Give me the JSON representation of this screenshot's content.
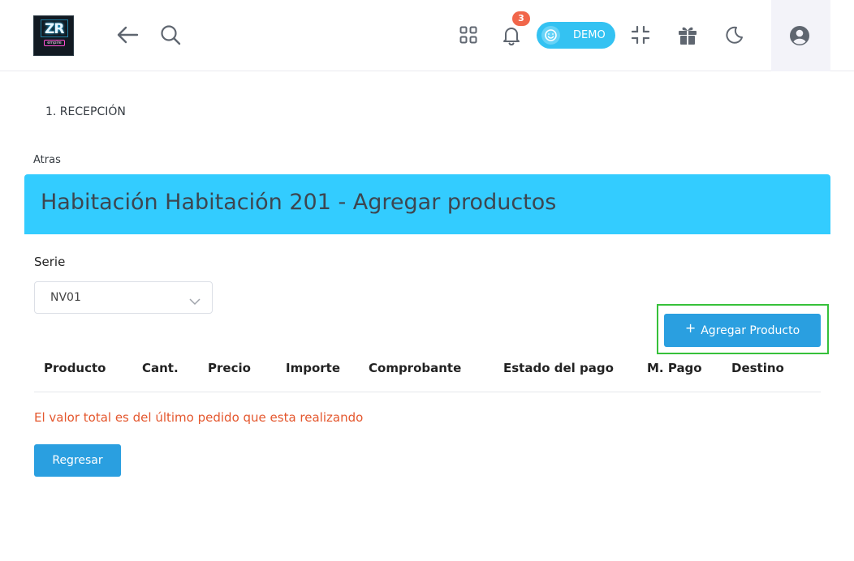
{
  "header": {
    "notification_count": "3",
    "demo_label": "DEMO",
    "icons": [
      "back-arrow-icon",
      "search-icon",
      "apps-grid-icon",
      "bell-icon",
      "smiley-icon",
      "compress-icon",
      "gift-icon",
      "moon-icon",
      "user-circle-icon"
    ]
  },
  "breadcrumb": "1. RECEPCIÓN",
  "back_link": "Atras",
  "banner": {
    "title": "Habitación Habitación 201 - Agregar productos",
    "color": "#33ccff"
  },
  "form": {
    "serie_label": "Serie",
    "serie_value": "NV01"
  },
  "add_product_button": {
    "icon": "+",
    "label": "Agregar Producto"
  },
  "table": {
    "columns": [
      "Producto",
      "Cant.",
      "Precio",
      "Importe",
      "Comprobante",
      "Estado del pago",
      "M. Pago",
      "Destino"
    ],
    "rows": []
  },
  "note": "El valor total es del último pedido que esta realizando",
  "return_button": "Regresar",
  "colors": {
    "primary_button": "#2a9fe0",
    "note_text": "#e4572e",
    "badge": "#f1664a",
    "highlight_box": "#36c13a"
  }
}
